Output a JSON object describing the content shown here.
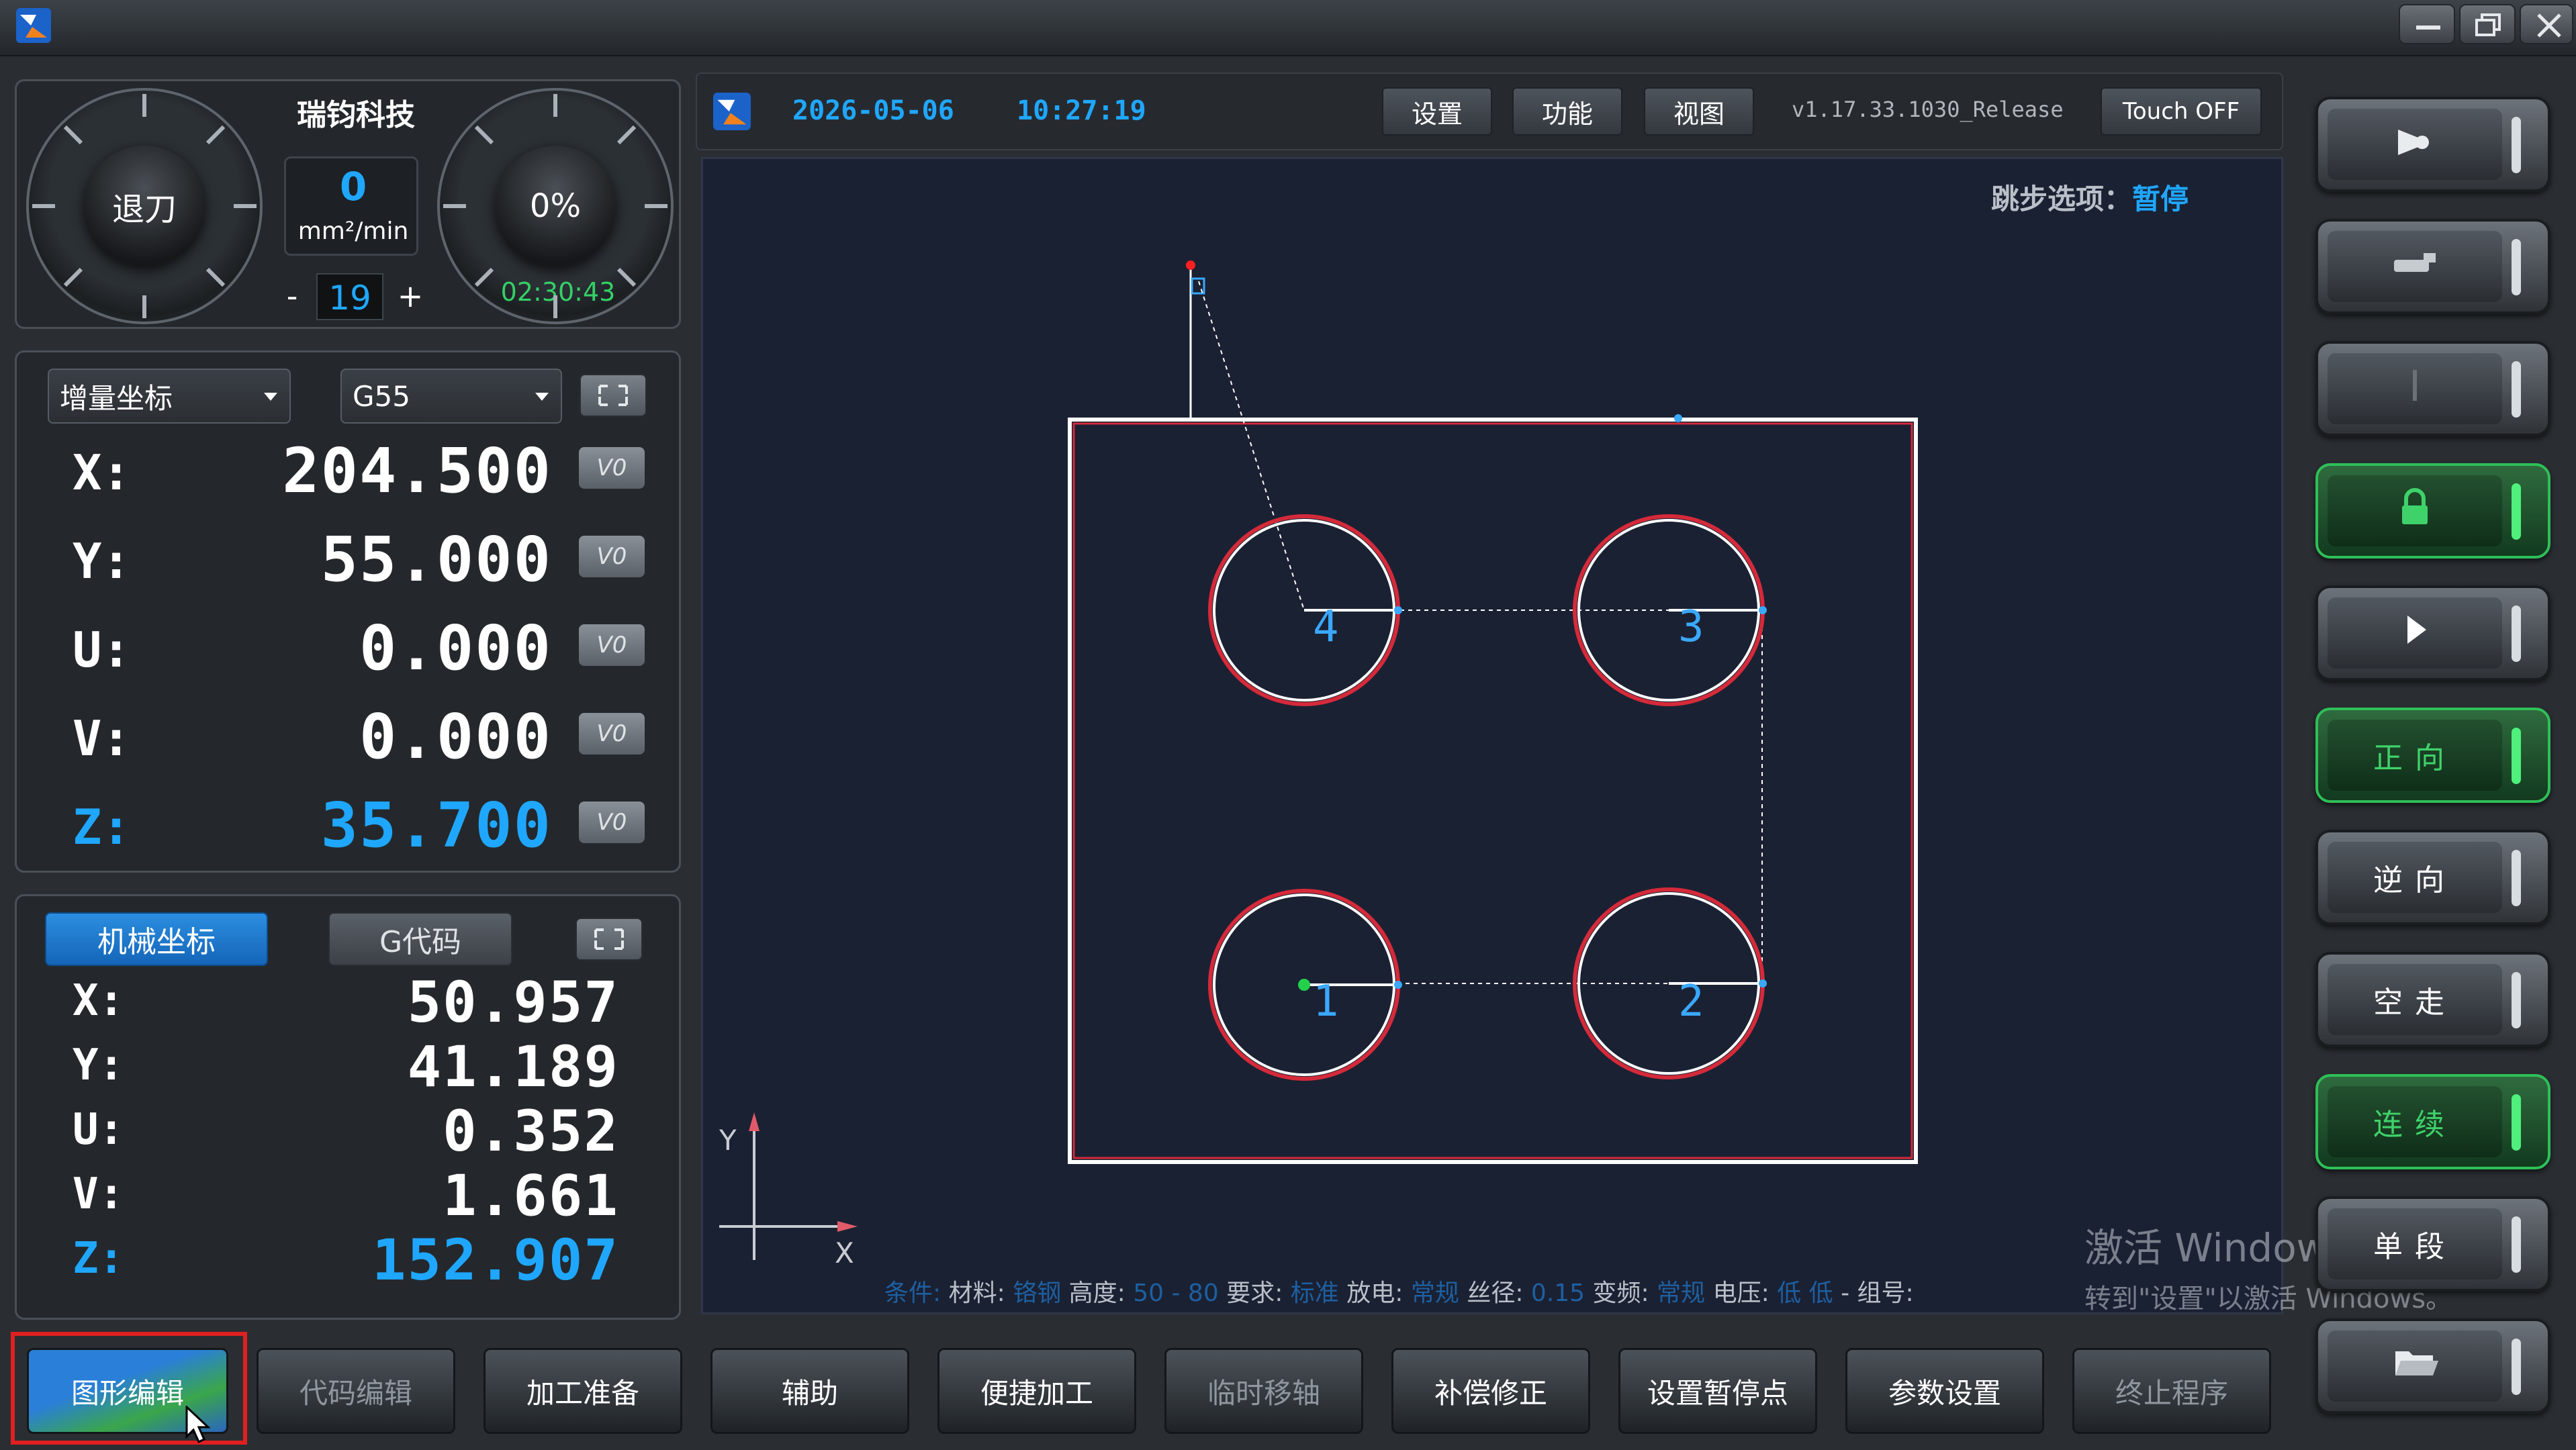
{
  "brand": {
    "name": "瑞钧科技"
  },
  "header": {
    "date": "2026-05-06",
    "time": "10:27:19",
    "menu": [
      "设置",
      "功能",
      "视图"
    ],
    "version": "v1.17.33.1030_Release",
    "touch_label": "Touch OFF"
  },
  "dials": {
    "left_knob_label": "退刀",
    "speed_value": "0",
    "speed_unit": "mm²/min",
    "stepper_minus": "-",
    "stepper_value": "19",
    "stepper_plus": "+",
    "right_knob_label": "0%",
    "timer": "02:30:43"
  },
  "coord_panel": {
    "mode_select": "增量坐标",
    "wcs_select": "G55",
    "v0_label": "V0",
    "rows": [
      {
        "axis": "X:",
        "value": "204.500"
      },
      {
        "axis": "Y:",
        "value": "55.000"
      },
      {
        "axis": "U:",
        "value": "0.000"
      },
      {
        "axis": "V:",
        "value": "0.000"
      },
      {
        "axis": "Z:",
        "value": "35.700"
      }
    ]
  },
  "machine_panel": {
    "tab_machine": "机械坐标",
    "tab_gcode": "G代码",
    "rows": [
      {
        "axis": "X:",
        "value": "50.957"
      },
      {
        "axis": "Y:",
        "value": "41.189"
      },
      {
        "axis": "U:",
        "value": "0.352"
      },
      {
        "axis": "V:",
        "value": "1.661"
      },
      {
        "axis": "Z:",
        "value": "152.907"
      }
    ]
  },
  "canvas": {
    "skip_label": "跳步选项：",
    "skip_value": "暂停",
    "axis_y": "Y",
    "axis_x": "X",
    "hole_numbers": [
      "4",
      "3",
      "1",
      "2"
    ],
    "status": {
      "condition": "条件:",
      "material_label": "材料:",
      "material_value": "铬钢",
      "height_label": "高度:",
      "height_value": "50 - 80",
      "req_label": "要求:",
      "req_value": "标准",
      "discharge_label": "放电:",
      "discharge_value": "常规",
      "wire_label": "丝径:",
      "wire_value": "0.15",
      "freq_label": "变频:",
      "freq_value": "常规",
      "volt_label": "电压:",
      "volt_value": "低 低",
      "group_label": "- 组号:"
    },
    "watermark_line1": "激活 Windows",
    "watermark_line2": "转到\"设置\"以激活 Windows。"
  },
  "side_buttons": [
    {
      "label": "",
      "icon": "light-icon",
      "state": "normal"
    },
    {
      "label": "",
      "icon": "pump-icon",
      "state": "normal"
    },
    {
      "label": "",
      "icon": "wire-icon",
      "state": "dim"
    },
    {
      "label": "",
      "icon": "lock-icon",
      "state": "green"
    },
    {
      "label": "",
      "icon": "play-icon",
      "state": "normal"
    },
    {
      "label": "正向",
      "icon": "",
      "state": "green"
    },
    {
      "label": "逆向",
      "icon": "",
      "state": "normal"
    },
    {
      "label": "空走",
      "icon": "",
      "state": "normal"
    },
    {
      "label": "连续",
      "icon": "",
      "state": "green"
    },
    {
      "label": "单段",
      "icon": "",
      "state": "normal"
    },
    {
      "label": "",
      "icon": "folder-icon",
      "state": "normal"
    }
  ],
  "bottom_buttons": [
    "图形编辑",
    "代码编辑",
    "加工准备",
    "辅助",
    "便捷加工",
    "临时移轴",
    "补偿修正",
    "设置暂停点",
    "参数设置",
    "终止程序"
  ],
  "colors": {
    "accent_blue": "#1fa7ff",
    "status_green": "#33d166",
    "highlight_red": "#e02020"
  }
}
